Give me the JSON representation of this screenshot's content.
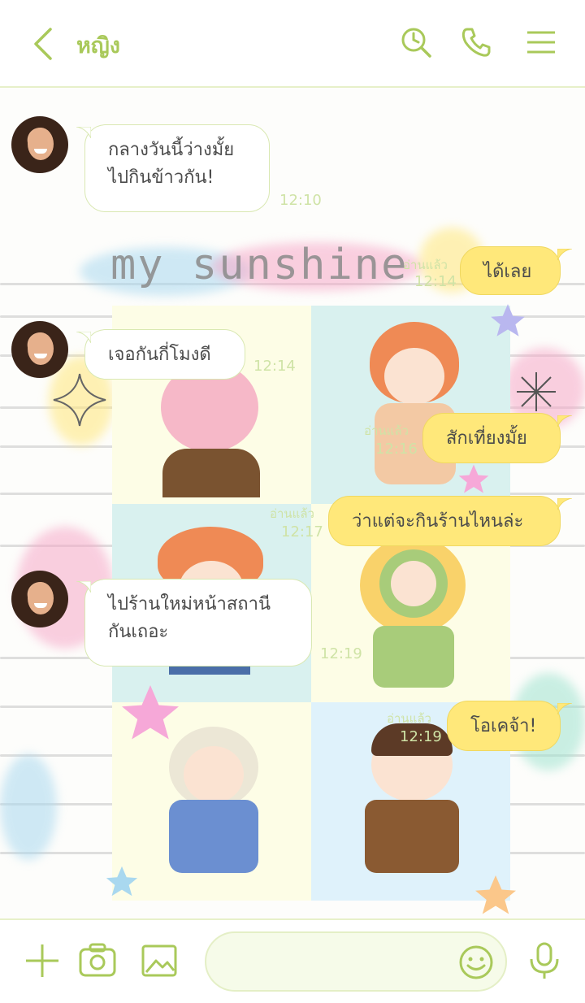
{
  "header": {
    "title": "หญิง",
    "icons": [
      "back-chevron-icon",
      "search-clock-icon",
      "phone-icon",
      "menu-icon"
    ]
  },
  "background": {
    "title_art": "my sunshine"
  },
  "messages": [
    {
      "side": "left",
      "lines": [
        "กลางวันนี้ว่างมั้ย",
        "ไปกินข้าวกัน!"
      ],
      "time": "12:10"
    },
    {
      "side": "right",
      "text": "ได้เลย",
      "read": "อ่านแล้ว",
      "time": "12:14"
    },
    {
      "side": "left",
      "text": "เจอกันกี่โมงดี",
      "time": "12:14"
    },
    {
      "side": "right",
      "text": "สักเที่ยงมั้ย",
      "read": "อ่านแล้ว",
      "time": "12:16"
    },
    {
      "side": "right",
      "text": "ว่าแต่จะกินร้านไหนล่ะ",
      "read": "อ่านแล้ว",
      "time": "12:17"
    },
    {
      "side": "left",
      "lines": [
        "ไปร้านใหม่หน้าสถานี",
        "กันเถอะ"
      ],
      "time": "12:19"
    },
    {
      "side": "right",
      "text": "โอเคจ้า!",
      "read": "อ่านแล้ว",
      "time": "12:19"
    }
  ],
  "footer": {
    "icons": [
      "plus-icon",
      "camera-icon",
      "image-icon",
      "emoji-icon",
      "microphone-icon"
    ],
    "input_placeholder": ""
  },
  "colors": {
    "accent": "#a9c95a",
    "bubble_right": "#ffe87a",
    "bubble_left_border": "#d9e8b2",
    "timestamp": "#cfe3a6"
  }
}
